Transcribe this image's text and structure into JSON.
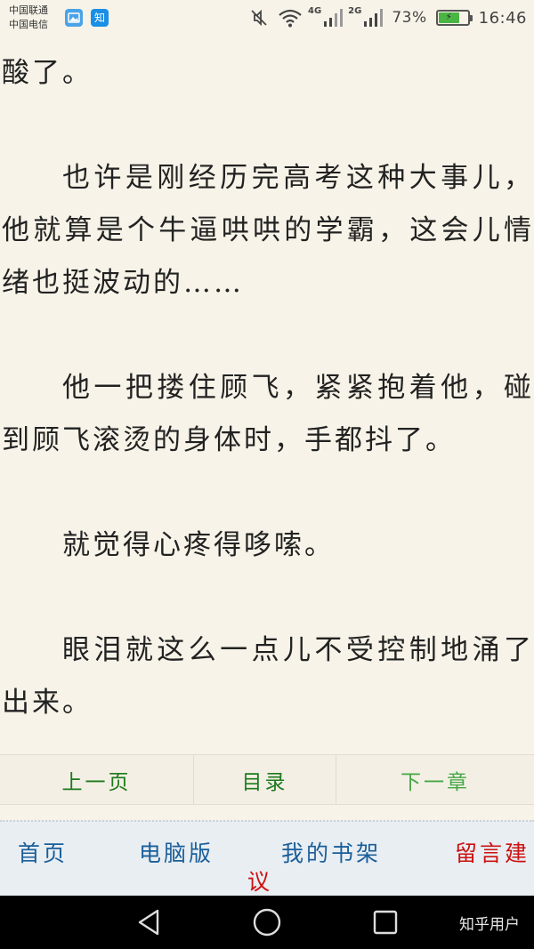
{
  "status_bar": {
    "carrier_1": "中国联通",
    "carrier_2": "中国电信",
    "notification_icons": [
      "gallery-icon",
      "zhihu-icon"
    ],
    "zhihu_glyph": "知",
    "network_1": "4G",
    "network_2": "2G",
    "battery_percent": "73%",
    "battery_level": 0.73,
    "time": "16:46"
  },
  "content": {
    "paragraphs": [
      "酸了。",
      "也许是刚经历完高考这种大事儿，他就算是个牛逼哄哄的学霸，这会儿情绪也挺波动的……",
      "他一把搂住顾飞，紧紧抱着他，碰到顾飞滚烫的身体时，手都抖了。",
      "就觉得心疼得哆嗦。",
      "眼泪就这么一点儿不受控制地涌了出来。"
    ]
  },
  "page_nav": {
    "prev": "上一页",
    "toc": "目录",
    "next": "下一章"
  },
  "site_footer": {
    "home": "首页",
    "pc_version": "电脑版",
    "bookshelf": "我的书架",
    "feedback_part1": "留言建",
    "feedback_part2": "议"
  },
  "system_nav": {
    "buttons": [
      "back-icon",
      "home-icon",
      "recents-icon"
    ],
    "watermark": "知乎用户"
  },
  "colors": {
    "background": "#f7f3e8",
    "nav_link": "#1d7a1d",
    "footer_link": "#1a5e9a",
    "feedback_link": "#cc1111",
    "battery": "#4bb543"
  }
}
